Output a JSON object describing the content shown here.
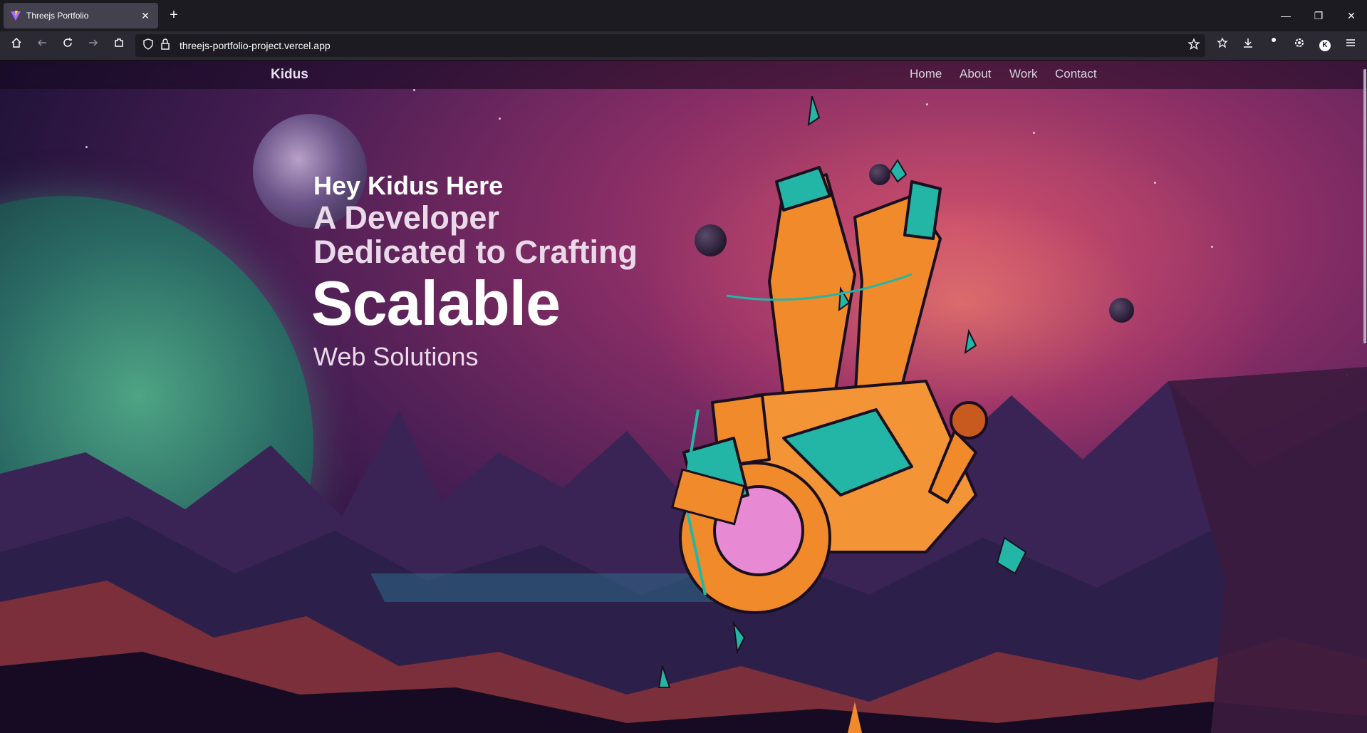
{
  "browser": {
    "tab_title": "Threejs Portfolio",
    "tab_close": "✕",
    "new_tab": "+",
    "url": "threejs-portfolio-project.vercel.app",
    "window_controls": {
      "minimize": "—",
      "restore": "❐",
      "close": "✕"
    },
    "toolbar_icons": [
      "home-icon",
      "back-icon",
      "reload-icon",
      "forward-icon",
      "extensions-icon",
      "shield-icon",
      "lock-icon",
      "bookmark-star-icon",
      "collections-icon",
      "download-icon",
      "wrench-icon",
      "gear-icon",
      "account-icon",
      "menu-icon"
    ],
    "account_initial": "K"
  },
  "site": {
    "brand": "Kidus",
    "nav": [
      {
        "label": "Home"
      },
      {
        "label": "About"
      },
      {
        "label": "Work"
      },
      {
        "label": "Contact"
      }
    ],
    "hero": {
      "greeting": "Hey Kidus Here",
      "line2": "A Developer",
      "line3": "Dedicated to Crafting",
      "headline": "Scalable",
      "line5": "Web Solutions"
    }
  },
  "colors": {
    "sky_pink": "#c7506a",
    "sky_purple": "#4a1f55",
    "planet_green": "#4ea484",
    "astronaut_orange": "#f08a2a",
    "astronaut_teal": "#23b6a6"
  }
}
